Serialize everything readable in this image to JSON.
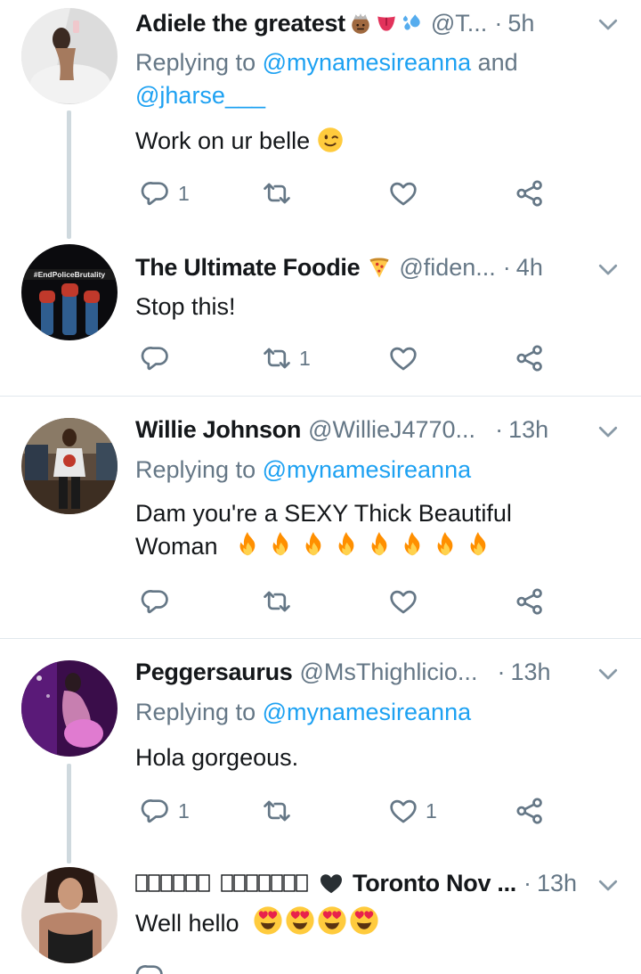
{
  "tweets": [
    {
      "name": "Adiele the greatest",
      "handle": "@T...",
      "dot": "·",
      "time": "5h",
      "replying_prefix": "Replying to ",
      "replying_mention_1": "@mynamesireanna",
      "replying_and": " and",
      "replying_mention_2": "@jharse___",
      "text": "Work on ur belle",
      "reply_count": "1",
      "retweet_count": "",
      "like_count": ""
    },
    {
      "name": "The Ultimate Foodie",
      "handle": "@fiden...",
      "dot": "·",
      "time": "4h",
      "avatar_text": "#EndPoliceBrutality",
      "text": "Stop this!",
      "reply_count": "",
      "retweet_count": "1",
      "like_count": ""
    },
    {
      "name": "Willie Johnson",
      "handle": "@WillieJ4770...",
      "dot": "·",
      "time": "13h",
      "replying_prefix": "Replying to ",
      "replying_mention_1": "@mynamesireanna",
      "text_line1": "Dam you're a SEXY Thick Beautiful",
      "text_line2": "Woman",
      "reply_count": "",
      "retweet_count": "",
      "like_count": ""
    },
    {
      "name": "Peggersaurus",
      "handle": "@MsThighlicio...",
      "dot": "·",
      "time": "13h",
      "replying_prefix": "Replying to ",
      "replying_mention_1": "@mynamesireanna",
      "text": "Hola gorgeous.",
      "reply_count": "1",
      "retweet_count": "",
      "like_count": "1"
    },
    {
      "name": "Toronto Nov ...",
      "handle": "",
      "dot": "·",
      "time": "13h",
      "text": "Well hello",
      "reply_count": "",
      "retweet_count": "",
      "like_count": ""
    }
  ],
  "icons": {
    "reply": "reply-icon",
    "retweet": "retweet-icon",
    "like": "heart-icon",
    "share": "share-icon",
    "caret": "chevron-down-icon"
  },
  "colors": {
    "mention": "#1da1f2",
    "secondary_text": "#657786",
    "icon": "#657786",
    "thread_line": "#cfd9de",
    "divider": "#e1e8ed"
  }
}
